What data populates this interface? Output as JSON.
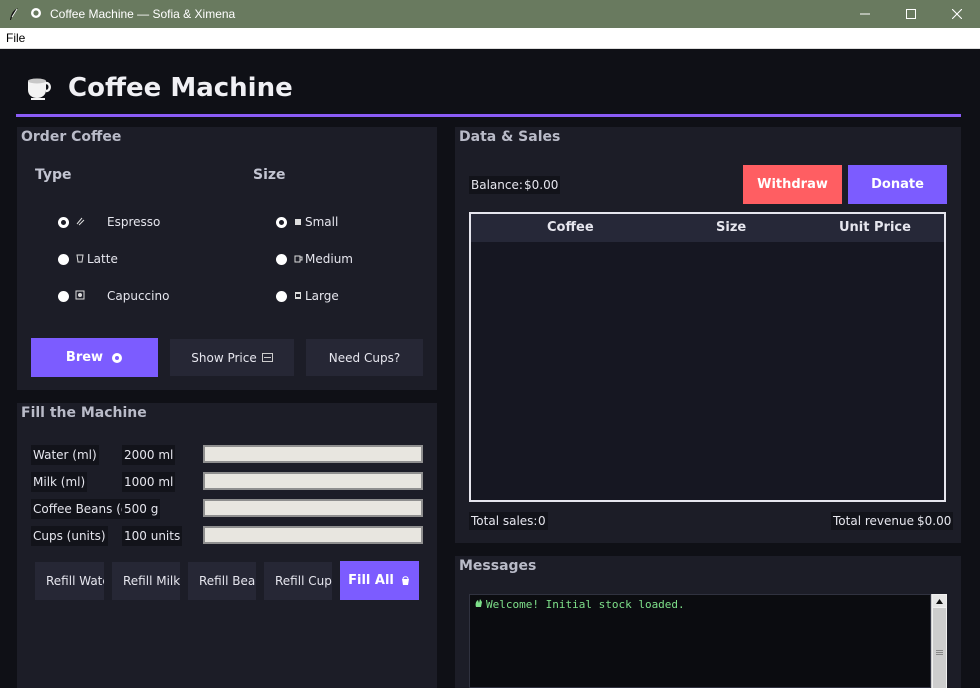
{
  "window": {
    "title": "Coffee Machine — Sofia & Ximena",
    "minimize": "—",
    "maximize": "☐",
    "close": "✕"
  },
  "menu": {
    "file": "File"
  },
  "header": {
    "title": "Coffee Machine"
  },
  "order": {
    "title": "Order Coffee",
    "type_label": "Type",
    "size_label": "Size",
    "types": [
      {
        "label": "Espresso",
        "icon": "espresso-icon",
        "selected": true
      },
      {
        "label": "Latte",
        "icon": "latte-icon",
        "selected": false
      },
      {
        "label": "Capuccino",
        "icon": "capuccino-icon",
        "selected": false
      }
    ],
    "sizes": [
      {
        "label": "Small",
        "icon": "small-cup-icon",
        "selected": true
      },
      {
        "label": "Medium",
        "icon": "medium-cup-icon",
        "selected": false
      },
      {
        "label": "Large",
        "icon": "large-cup-icon",
        "selected": false
      }
    ],
    "brew_label": "Brew",
    "show_price_label": "Show Price",
    "need_cups_label": "Need Cups?"
  },
  "fill": {
    "title": "Fill the Machine",
    "rows": [
      {
        "label": "Water (ml)",
        "value": "2000 ml",
        "level": 1.0
      },
      {
        "label": "Milk (ml)",
        "value": "1000 ml",
        "level": 1.0
      },
      {
        "label": "Coffee Beans (g)",
        "value": "500 g",
        "level": 1.0
      },
      {
        "label": "Cups (units)",
        "value": "100 units",
        "level": 1.0
      }
    ],
    "refill_water": "Refill Water",
    "refill_milk": "Refill Milk",
    "refill_beans": "Refill Beans",
    "refill_cups": "Refill Cups",
    "fill_all": "Fill All"
  },
  "sales": {
    "title": "Data & Sales",
    "balance_label": "Balance:",
    "balance_value": "$0.00",
    "withdraw_label": "Withdraw",
    "donate_label": "Donate",
    "columns": [
      "Coffee",
      "Size",
      "Unit Price"
    ],
    "total_sales_label": "Total sales:",
    "total_sales_value": "0",
    "total_revenue_label": "Total revenue:",
    "total_revenue_value": "$0.00"
  },
  "messages": {
    "title": "Messages",
    "lines": [
      "Welcome! Initial stock loaded."
    ]
  },
  "colors": {
    "accent": "#7c5cff",
    "danger": "#ff5e62",
    "titlebar": "#697a5f",
    "message_text": "#7ee08a"
  }
}
